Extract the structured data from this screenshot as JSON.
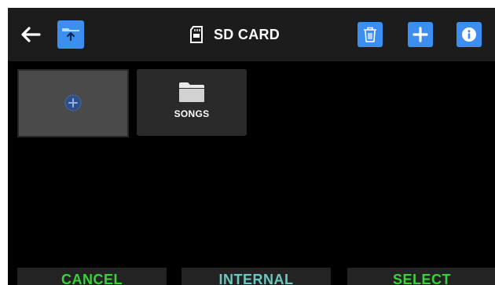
{
  "header": {
    "title": "SD CARD",
    "back_icon": "arrow-left-icon",
    "up_folder_icon": "folder-up-icon",
    "storage_icon": "sd-card-icon",
    "delete_icon": "trash-icon",
    "add_icon": "plus-icon",
    "info_icon": "info-icon"
  },
  "files": [
    {
      "type": "add",
      "icon": "plus-circle-icon"
    },
    {
      "type": "folder",
      "label": "SONGS",
      "icon": "folder-icon"
    }
  ],
  "footer": {
    "cancel_label": "CANCEL",
    "internal_label": "INTERNAL",
    "select_label": "SELECT"
  },
  "colors": {
    "accent_blue": "#3d8fef",
    "green": "#3bd13b",
    "teal": "#6fc8c0",
    "bar": "#1c1c1c"
  }
}
